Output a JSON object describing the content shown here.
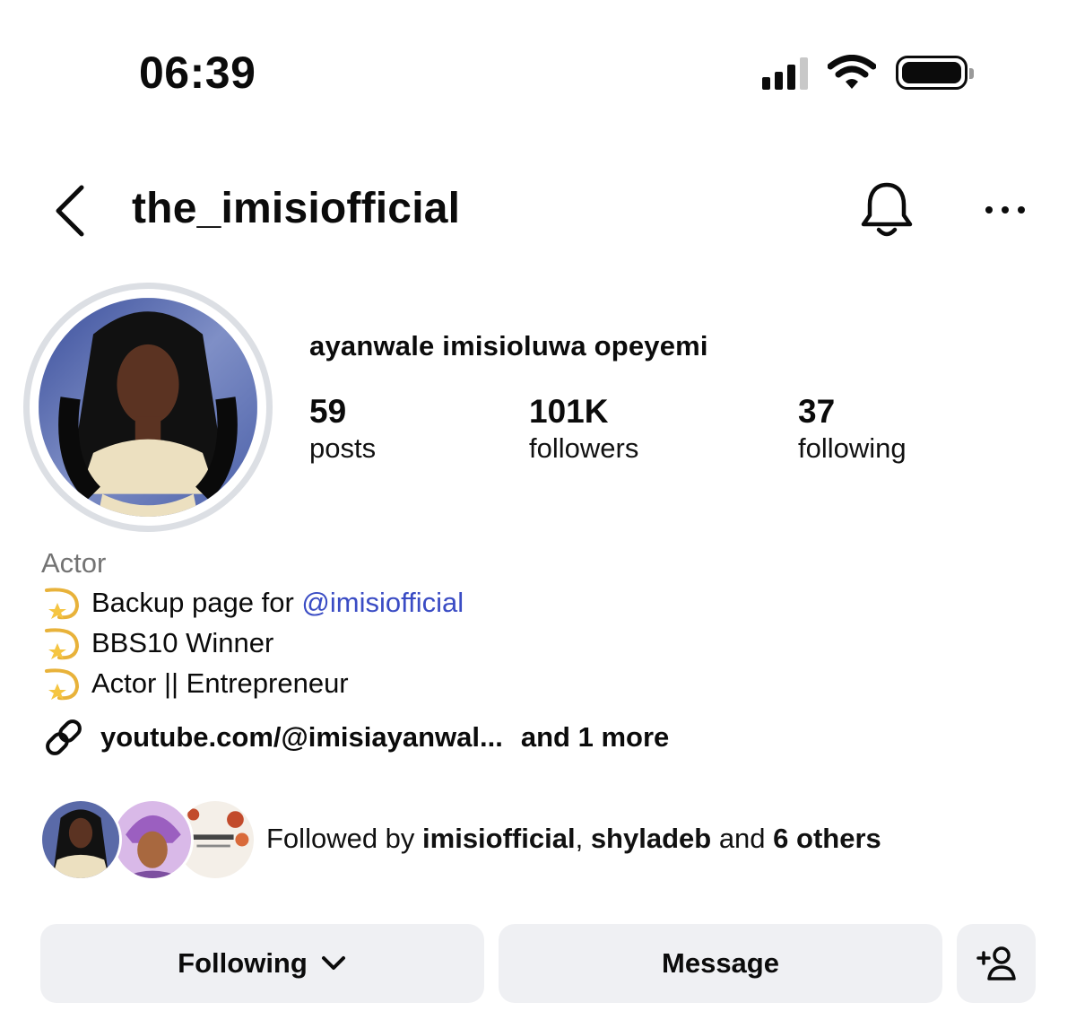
{
  "status_bar": {
    "time": "06:39",
    "icons": [
      "signal-icon",
      "wifi-icon",
      "battery-icon"
    ]
  },
  "header": {
    "username": "the_imisiofficial",
    "icons": [
      "back-chevron-icon",
      "bell-icon",
      "more-dots-icon"
    ]
  },
  "profile": {
    "full_name": "ayanwale imisioluwa opeyemi",
    "stats": {
      "posts": {
        "value": "59",
        "label": "posts"
      },
      "followers": {
        "value": "101K",
        "label": "followers"
      },
      "following": {
        "value": "37",
        "label": "following"
      }
    }
  },
  "bio": {
    "category": "Actor",
    "lines": [
      {
        "prefix": "Backup page for ",
        "mention": "@imisiofficial"
      },
      {
        "text": "BBS10 Winner"
      },
      {
        "text": "Actor || Entrepreneur"
      }
    ],
    "link": "youtube.com/@imisiayanwal...",
    "link_more": "and 1 more"
  },
  "followed_by": {
    "prefix": "Followed by ",
    "user1": "imisiofficial",
    "sep": ", ",
    "user2": "shyladeb",
    "and": " and ",
    "others": "6 others"
  },
  "actions": {
    "following_label": "Following",
    "message_label": "Message"
  },
  "colors": {
    "mention": "#3a4cc4",
    "button_bg": "#eff0f3",
    "category": "#737373"
  }
}
